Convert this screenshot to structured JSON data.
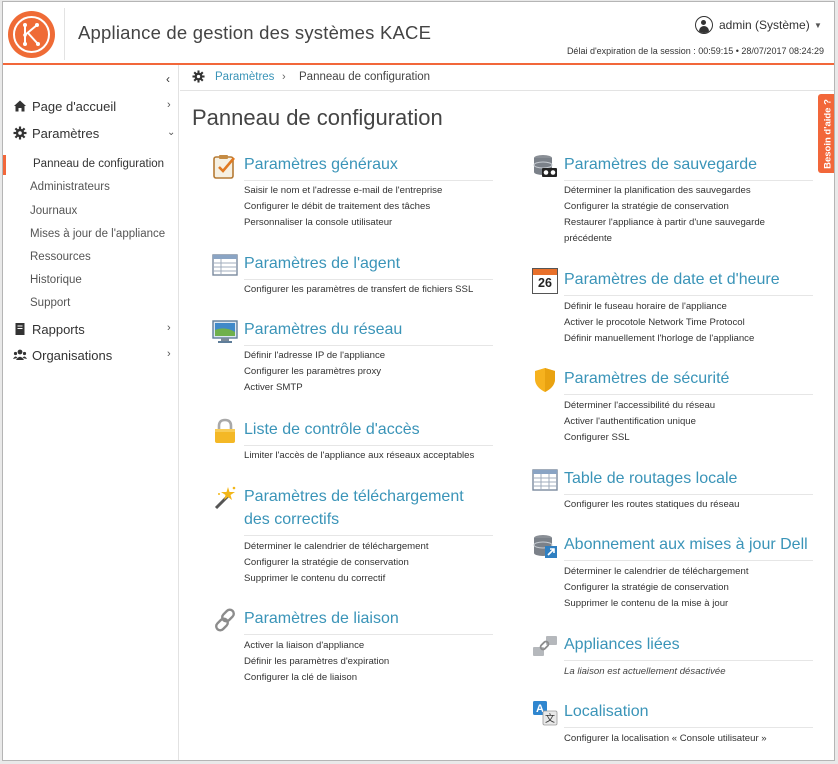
{
  "header": {
    "app_title": "Appliance de gestion des systèmes KACE",
    "user_label": "admin (Système)",
    "session_text": "Délai d'expiration de la session : 00:59:15 • 28/07/2017 08:24:29",
    "logo_letter": "K",
    "accent_color": "#f2673a"
  },
  "sidebar": {
    "collapse_icon": "chevron-left-icon",
    "items": [
      {
        "label": "Page d'accueil",
        "icon": "home-icon"
      },
      {
        "label": "Paramètres",
        "icon": "gear-icon"
      },
      {
        "label": "Rapports",
        "icon": "book-icon"
      },
      {
        "label": "Organisations",
        "icon": "users-icon"
      }
    ],
    "sub_items": [
      "Panneau de configuration",
      "Administrateurs",
      "Journaux",
      "Mises à jour de l'appliance",
      "Ressources",
      "Historique",
      "Support"
    ]
  },
  "breadcrumb": {
    "parent": "Paramètres",
    "separator": "›",
    "current": "Panneau de configuration"
  },
  "main": {
    "title": "Panneau de configuration",
    "help_tab": "Besoin d'aide ?",
    "left_sections": [
      {
        "title": "Paramètres généraux",
        "icon": "clipboard-check-icon",
        "links": [
          "Saisir le nom et l'adresse e-mail de l'entreprise",
          "Configurer le débit de traitement des tâches",
          "Personnaliser la console utilisateur"
        ]
      },
      {
        "title": "Paramètres de l'agent",
        "icon": "table-window-icon",
        "links": [
          "Configurer les paramètres de transfert de fichiers SSL"
        ]
      },
      {
        "title": "Paramètres du réseau",
        "icon": "monitor-icon",
        "links": [
          "Définir l'adresse IP de l'appliance",
          "Configurer les paramètres proxy",
          "Activer SMTP"
        ]
      },
      {
        "title": "Liste de contrôle d'accès",
        "icon": "padlock-icon",
        "links": [
          "Limiter l'accès de l'appliance aux réseaux acceptables"
        ]
      },
      {
        "title": "Paramètres de téléchargement des correctifs",
        "icon": "magic-wand-icon",
        "links": [
          "Déterminer le calendrier de téléchargement",
          "Configurer la stratégie de conservation",
          "Supprimer le contenu du correctif"
        ]
      },
      {
        "title": "Paramètres de liaison",
        "icon": "chain-link-icon",
        "links": [
          "Activer la liaison d'appliance",
          "Définir les paramètres d'expiration",
          "Configurer la clé de liaison"
        ]
      }
    ],
    "right_sections": [
      {
        "title": "Paramètres de sauvegarde",
        "icon": "database-backup-icon",
        "links": [
          "Déterminer la planification des sauvegardes",
          "Configurer la stratégie de conservation",
          "Restaurer l'appliance à partir d'une sauvegarde précédente"
        ]
      },
      {
        "title": "Paramètres de date et d'heure",
        "icon": "calendar-icon",
        "calendar_day": "26",
        "links": [
          "Définir le fuseau horaire de l'appliance",
          "Activer le procotole Network Time Protocol",
          "Définir manuellement l'horloge de l'appliance"
        ]
      },
      {
        "title": "Paramètres de sécurité",
        "icon": "shield-icon",
        "links": [
          "Déterminer l'accessibilité du réseau",
          "Activer l'authentification unique",
          "Configurer SSL"
        ]
      },
      {
        "title": "Table de routages locale",
        "icon": "routing-table-icon",
        "links": [
          "Configurer les routes statiques du réseau"
        ]
      },
      {
        "title": "Abonnement aux mises à jour Dell",
        "icon": "database-update-icon",
        "links": [
          "Déterminer le calendrier de téléchargement",
          "Configurer la stratégie de conservation",
          "Supprimer le contenu de la mise à jour"
        ]
      },
      {
        "title": "Appliances liées",
        "icon": "linked-appliances-icon",
        "note": "La liaison est actuellement désactivée"
      },
      {
        "title": "Localisation",
        "icon": "translate-icon",
        "translate_glyphs": [
          "A",
          "文"
        ],
        "links": [
          "Configurer la localisation « Console utilisateur »"
        ]
      }
    ]
  }
}
